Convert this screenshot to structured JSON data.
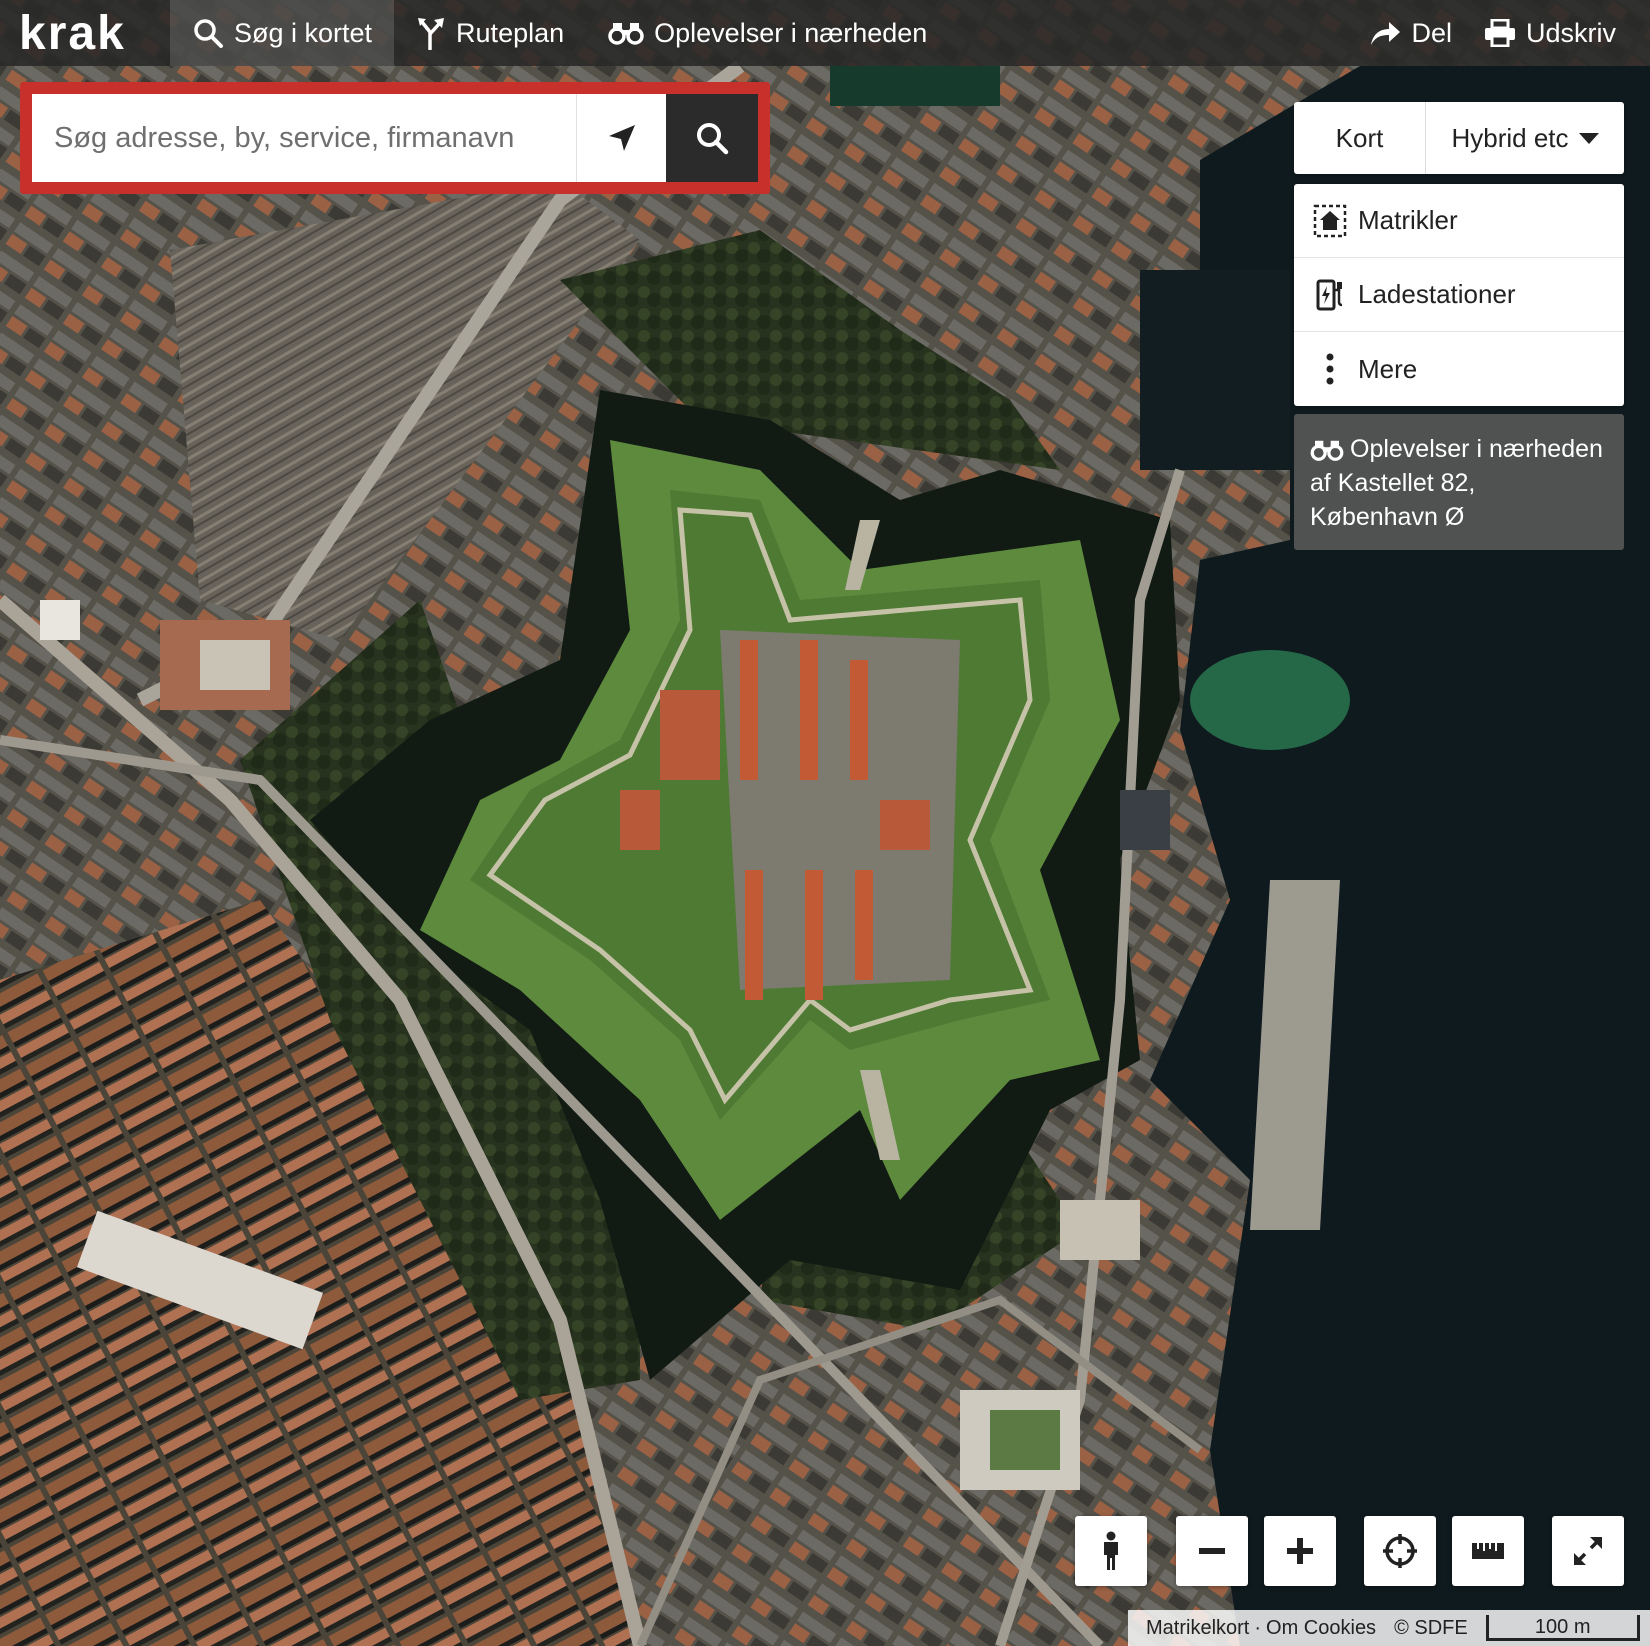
{
  "topbar": {
    "logo_text": "krak",
    "nav": [
      {
        "label": "Søg i kortet",
        "icon": "search-icon",
        "active": true
      },
      {
        "label": "Ruteplan",
        "icon": "route-icon",
        "active": false
      },
      {
        "label": "Oplevelser i nærheden",
        "icon": "binoculars-icon",
        "active": false
      }
    ],
    "share_label": "Del",
    "print_label": "Udskriv"
  },
  "search": {
    "placeholder": "Søg adresse, by, service, firmanavn",
    "value": ""
  },
  "layers": {
    "kort_label": "Kort",
    "selected_label": "Hybrid etc"
  },
  "overlays": [
    {
      "label": "Matrikler",
      "icon": "cadastre-icon"
    },
    {
      "label": "Ladestationer",
      "icon": "charging-station-icon"
    },
    {
      "label": "Mere",
      "icon": "more-vertical-icon"
    }
  ],
  "nearby": {
    "line1": "Oplevelser i nærheden",
    "line2": "af Kastellet 82,",
    "line3": "København Ø"
  },
  "controls": [
    {
      "name": "street-view-button",
      "icon": "person-icon"
    },
    {
      "name": "zoom-out-button",
      "icon": "minus-icon"
    },
    {
      "name": "zoom-in-button",
      "icon": "plus-icon"
    },
    {
      "name": "my-location-button",
      "icon": "crosshair-icon"
    },
    {
      "name": "measure-button",
      "icon": "ruler-icon"
    },
    {
      "name": "fullscreen-button",
      "icon": "expand-icon"
    }
  ],
  "attribution": {
    "matrikelkort": "Matrikelkort",
    "separator": "·",
    "cookies": "Om Cookies",
    "copyright": "© SDFE",
    "scale_label": "100 m"
  },
  "colors": {
    "accent_red": "#c8312b",
    "topbar_bg": "#282828",
    "water": "#0f1a1e",
    "moat": "#111b14",
    "grass": "#5f8a3e"
  }
}
